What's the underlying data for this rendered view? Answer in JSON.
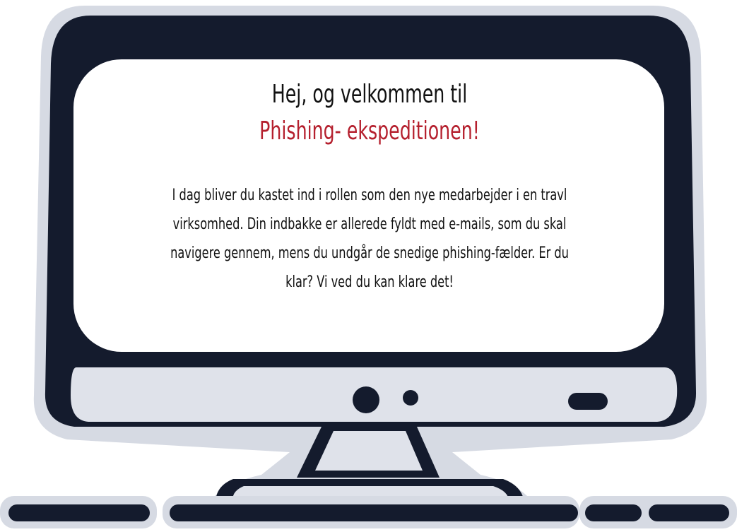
{
  "welcome": {
    "greeting": "Hej, og velkommen til",
    "title": "Phishing- ekspeditionen!",
    "intro": "I dag bliver du kastet ind i rollen som den nye medarbejder i en travl virksomhed. Din indbakke er allerede fyldt med e-mails, som du skal navigere gennem, mens du undgår de snedige phishing-fælder. Er du klar? Vi ved du kan klare det!"
  },
  "colors": {
    "frame": "#141b2d",
    "outline": "#d6dae3",
    "chin": "#dfe2ea",
    "accent": "#b5202e"
  },
  "icons": [
    "monitor-illustration",
    "keyboard-illustration"
  ]
}
